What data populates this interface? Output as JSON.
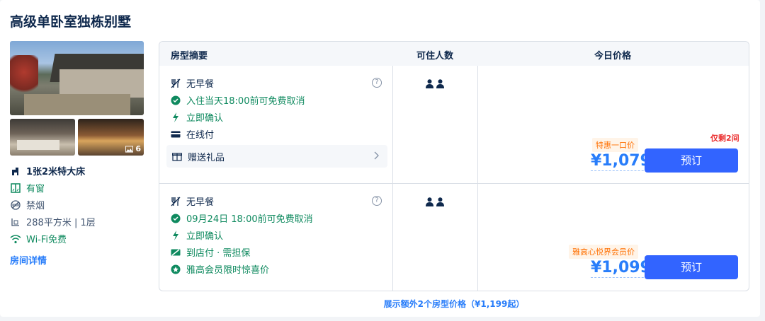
{
  "room": {
    "title": "高级单卧室独栋别墅",
    "photo_count": "6",
    "features": {
      "bed": "1张2米特大床",
      "window": "有窗",
      "smoking": "禁烟",
      "area": "288平方米 | 1层",
      "wifi": "Wi-Fi免费"
    },
    "detail_link": "房间详情"
  },
  "table": {
    "headers": {
      "summary": "房型摘要",
      "occupancy": "可住人数",
      "price": "今日价格"
    },
    "rows": [
      {
        "breakfast": "无早餐",
        "cancel": "入住当天18:00前可免费取消",
        "confirm": "立即确认",
        "payment": "在线付",
        "gift": "赠送礼品",
        "help": "?",
        "tag": "特惠一口价",
        "remaining": "仅剩2间",
        "price": "¥1,079",
        "book": "预订"
      },
      {
        "breakfast": "无早餐",
        "cancel": "09月24日 18:00前可免费取消",
        "confirm": "立即确认",
        "payment": "到店付 · 需担保",
        "member": "雅高会员限时惊喜价",
        "help": "?",
        "tag": "雅高心悦界会员价",
        "price": "¥1,099",
        "book": "预订"
      }
    ]
  },
  "more_link": "展示额外2个房型价格（¥1,199起）",
  "colors": {
    "accent": "#287dfa",
    "button": "#3264ff",
    "green": "#0f8a5f",
    "orange": "#ff6f00",
    "red": "#eb2d2d"
  }
}
